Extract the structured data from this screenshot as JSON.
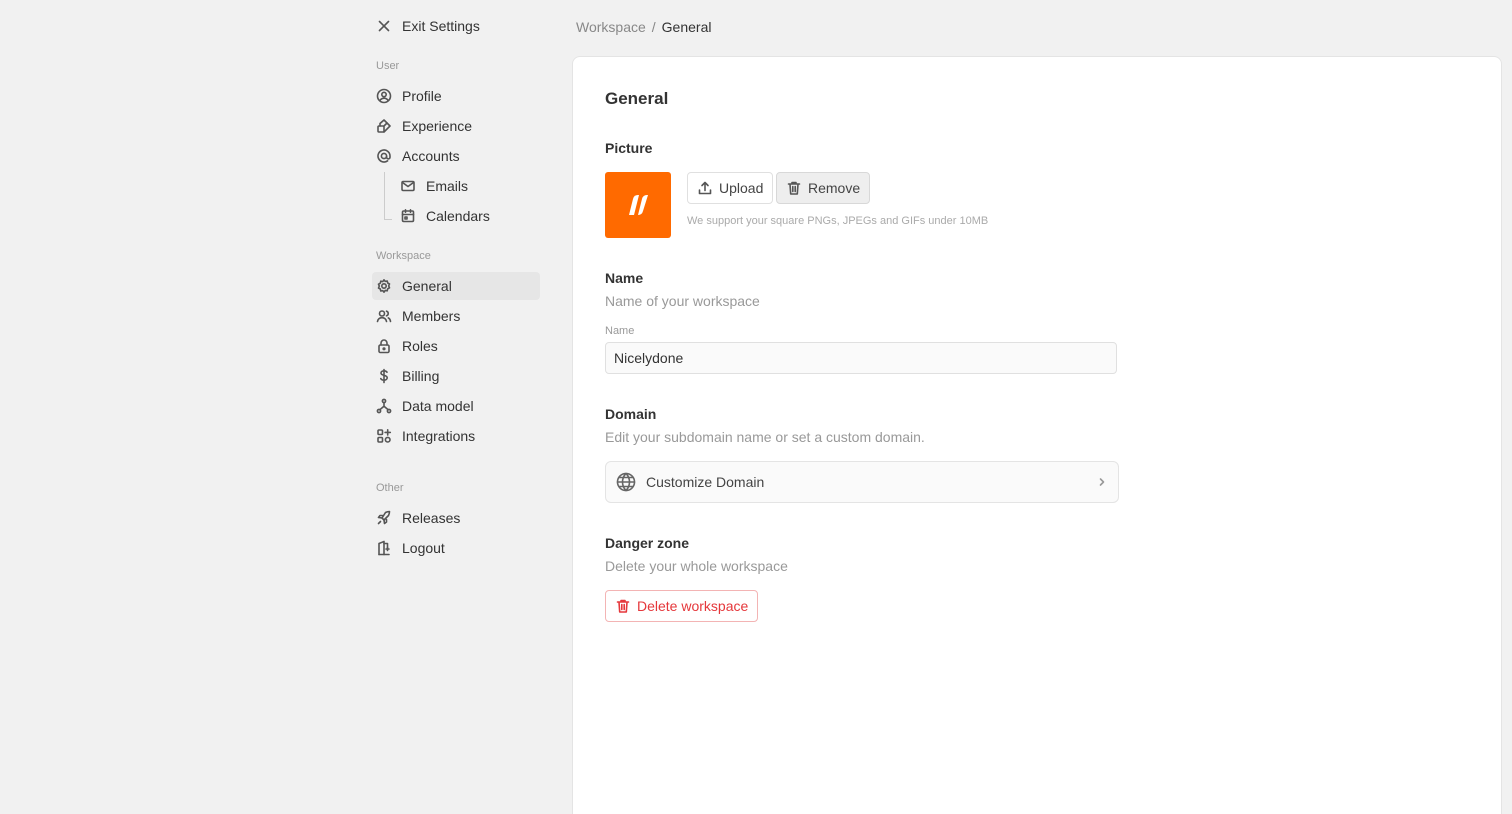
{
  "sidebar": {
    "exit_label": "Exit Settings",
    "sections": {
      "user": "User",
      "workspace": "Workspace",
      "other": "Other"
    },
    "items": {
      "profile": "Profile",
      "experience": "Experience",
      "accounts": "Accounts",
      "emails": "Emails",
      "calendars": "Calendars",
      "general": "General",
      "members": "Members",
      "roles": "Roles",
      "billing": "Billing",
      "data_model": "Data model",
      "integrations": "Integrations",
      "releases": "Releases",
      "logout": "Logout"
    },
    "active_item": "General"
  },
  "breadcrumb": {
    "parent": "Workspace",
    "separator": "/",
    "current": "General"
  },
  "main": {
    "title": "General",
    "picture": {
      "heading": "Picture",
      "upload_label": "Upload",
      "remove_label": "Remove",
      "hint": "We support your square PNGs, JPEGs and GIFs under 10MB",
      "logo_color": "#ff6a00"
    },
    "name": {
      "heading": "Name",
      "description": "Name of your workspace",
      "field_label": "Name",
      "value": "Nicelydone"
    },
    "domain": {
      "heading": "Domain",
      "description": "Edit your subdomain name or set a custom domain.",
      "action_label": "Customize Domain"
    },
    "danger": {
      "heading": "Danger zone",
      "description": "Delete your whole workspace",
      "delete_label": "Delete workspace",
      "color": "#e5373b"
    }
  }
}
